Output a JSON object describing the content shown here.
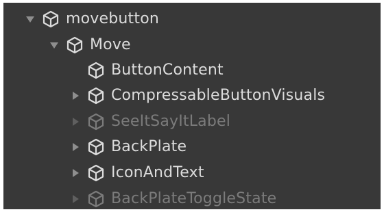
{
  "hierarchy": {
    "items": [
      {
        "label": "movebutton",
        "toggle": "expanded",
        "active": true,
        "icon": "gameobject-cube-icon"
      },
      {
        "label": "Move",
        "toggle": "expanded",
        "active": true,
        "icon": "gameobject-cube-icon"
      },
      {
        "label": "ButtonContent",
        "toggle": "none",
        "active": true,
        "icon": "gameobject-cube-icon"
      },
      {
        "label": "CompressableButtonVisuals",
        "toggle": "collapsed",
        "active": true,
        "icon": "gameobject-cube-icon"
      },
      {
        "label": "SeeItSayItLabel",
        "toggle": "collapsed",
        "active": false,
        "icon": "gameobject-cube-icon"
      },
      {
        "label": "BackPlate",
        "toggle": "collapsed",
        "active": true,
        "icon": "gameobject-cube-icon"
      },
      {
        "label": "IconAndText",
        "toggle": "collapsed",
        "active": true,
        "icon": "gameobject-cube-icon"
      },
      {
        "label": "BackPlateToggleState",
        "toggle": "collapsed",
        "active": false,
        "icon": "gameobject-cube-icon"
      }
    ]
  },
  "colors": {
    "panel_background": "#383838",
    "active_text": "#dcdcdc",
    "inactive_text": "#7b7b7b"
  }
}
